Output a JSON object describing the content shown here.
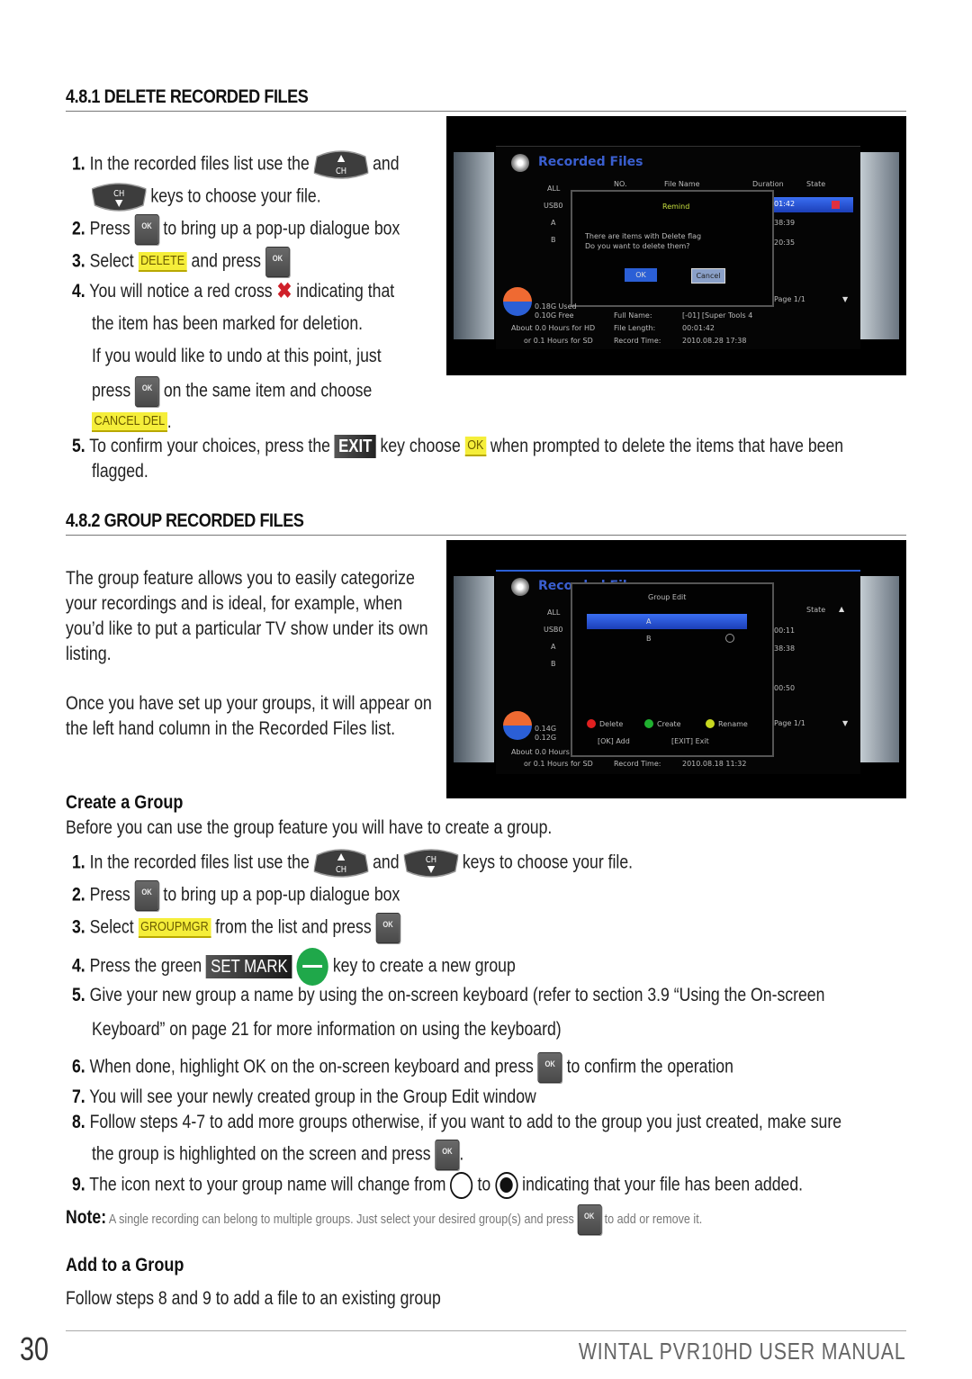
{
  "section_481": {
    "heading": "4.8.1 DELETE RECORDED FILES",
    "steps": [
      {
        "num": "1.",
        "a": "In the recorded files list use the",
        "b": "and",
        "c": "keys to choose your file."
      },
      {
        "num": "2.",
        "a": "Press",
        "b": "to bring up a pop-up dialogue box"
      },
      {
        "num": "3.",
        "a": "Select",
        "highlight": "DELETE",
        "b": "and press"
      },
      {
        "num": "4.",
        "a": "You will notice a red cross",
        "b": "indicating that",
        "c": "the item has been marked for deletion.",
        "d": "If you would like to undo at this point, just",
        "e": "press",
        "f": "on the same item and choose",
        "highlight": "CANCEL DEL",
        "g": "."
      },
      {
        "num": "5.",
        "a": "To confirm your choices, press the",
        "key": "EXIT",
        "b": "key choose",
        "highlight": "OK",
        "c": "when prompted to delete the items that have been",
        "d": "flagged."
      }
    ],
    "screenshot": {
      "title": "Recorded Files",
      "groups": [
        "ALL",
        "USB0",
        "A",
        "B"
      ],
      "columns": [
        "NO.",
        "File Name",
        "Duration",
        "State"
      ],
      "durations": [
        "01:42",
        "38:39",
        "20:35"
      ],
      "dialog_title": "Remind",
      "dialog_text_1": "There are items with Delete flag",
      "dialog_text_2": "Do you want to delete them?",
      "dialog_ok": "OK",
      "dialog_cancel": "Cancel",
      "page": "Page  1/1",
      "used": "0.18G Used",
      "free": "0.10G Free",
      "hours_hd": "About 0.0 Hours for HD",
      "hours_sd": "or 0.1 Hours for SD",
      "full_name_label": "Full Name:",
      "full_name": "[-01] [Super Tools 4",
      "file_length_label": "File Length:",
      "file_length": "00:01:42",
      "record_time_label": "Record Time:",
      "record_time": "2010.08.28 17:38"
    }
  },
  "section_482": {
    "heading": "4.8.2 GROUP RECORDED FILES",
    "intro_1": "The group feature allows you to easily categorize your recordings and is ideal, for example, when you’d like to put a particular TV show under its own listing.",
    "intro_2": "Once you have set up your groups, it will appear on the left hand column in the Recorded Files list.",
    "screenshot": {
      "title": "Recorded Files",
      "groups": [
        "ALL",
        "USB0",
        "A",
        "B"
      ],
      "dialog_title": "Group Edit",
      "items": [
        "A",
        "B"
      ],
      "legend_delete": "Delete",
      "legend_create": "Create",
      "legend_rename": "Rename",
      "ok_hint": "[OK]   Add",
      "exit_hint": "[EXIT]   Exit",
      "durations": [
        "00:11",
        "38:38",
        "00:50"
      ],
      "state_header": "State",
      "page": "Page  1/1",
      "used": "0.14G",
      "free": "0.12G",
      "hours_hd": "About 0.0 Hours",
      "hours_sd": "or 0.1 Hours for SD",
      "record_time_label": "Record Time:",
      "record_time": "2010.08.18 11:32",
      "colors": {
        "delete": "#e02020",
        "create": "#20b030",
        "rename": "#c8d820"
      }
    }
  },
  "create_group": {
    "heading": "Create a Group",
    "intro": "Before you can use the group feature you will have to create a group.",
    "steps": [
      {
        "num": "1.",
        "a": "In the recorded files list use the",
        "b": "and",
        "c": "keys to choose your file."
      },
      {
        "num": "2.",
        "a": "Press",
        "b": "to bring up a pop-up dialogue box"
      },
      {
        "num": "3.",
        "a": "Select",
        "highlight": "GROUPMGR",
        "b": "from the list and press"
      },
      {
        "num": "4.",
        "a": "Press the green",
        "key": "SET MARK",
        "b": "key to create a new group"
      },
      {
        "num": "5.",
        "a": "Give your new group a name by using the on-screen keyboard (refer to section 3.9 “Using the On-screen",
        "b": "Keyboard” on page 21 for more information on using the keyboard)"
      },
      {
        "num": "6.",
        "a": "When done, highlight OK on the on-screen keyboard and press",
        "b": "to confirm the operation"
      },
      {
        "num": "7.",
        "a": "You will see your newly created group in the Group Edit window"
      },
      {
        "num": "8.",
        "a": "Follow steps 4-7 to add more groups otherwise, if you want to add to the group you just created, make sure",
        "b": "the group is highlighted on the screen and press",
        "c": "."
      },
      {
        "num": "9.",
        "a": "The icon next to your group name will change from",
        "b": "to",
        "c": "indicating that your file has been added."
      }
    ],
    "note_label": "Note:",
    "note_a": "A single recording can belong to multiple groups. Just select your desired group(s) and press",
    "note_b": "to add or remove it."
  },
  "add_group": {
    "heading": "Add to a Group",
    "text": "Follow steps 8 and 9 to add a file to an existing group"
  },
  "keys": {
    "ok": "OK",
    "ch": "CH"
  },
  "footer": {
    "page_number": "30",
    "title": "WINTAL PVR10HD USER MANUAL"
  },
  "colors": {
    "highlight": "#f5ee3a",
    "green_key": "#1fa84a",
    "red_cross": "#d0202a"
  }
}
